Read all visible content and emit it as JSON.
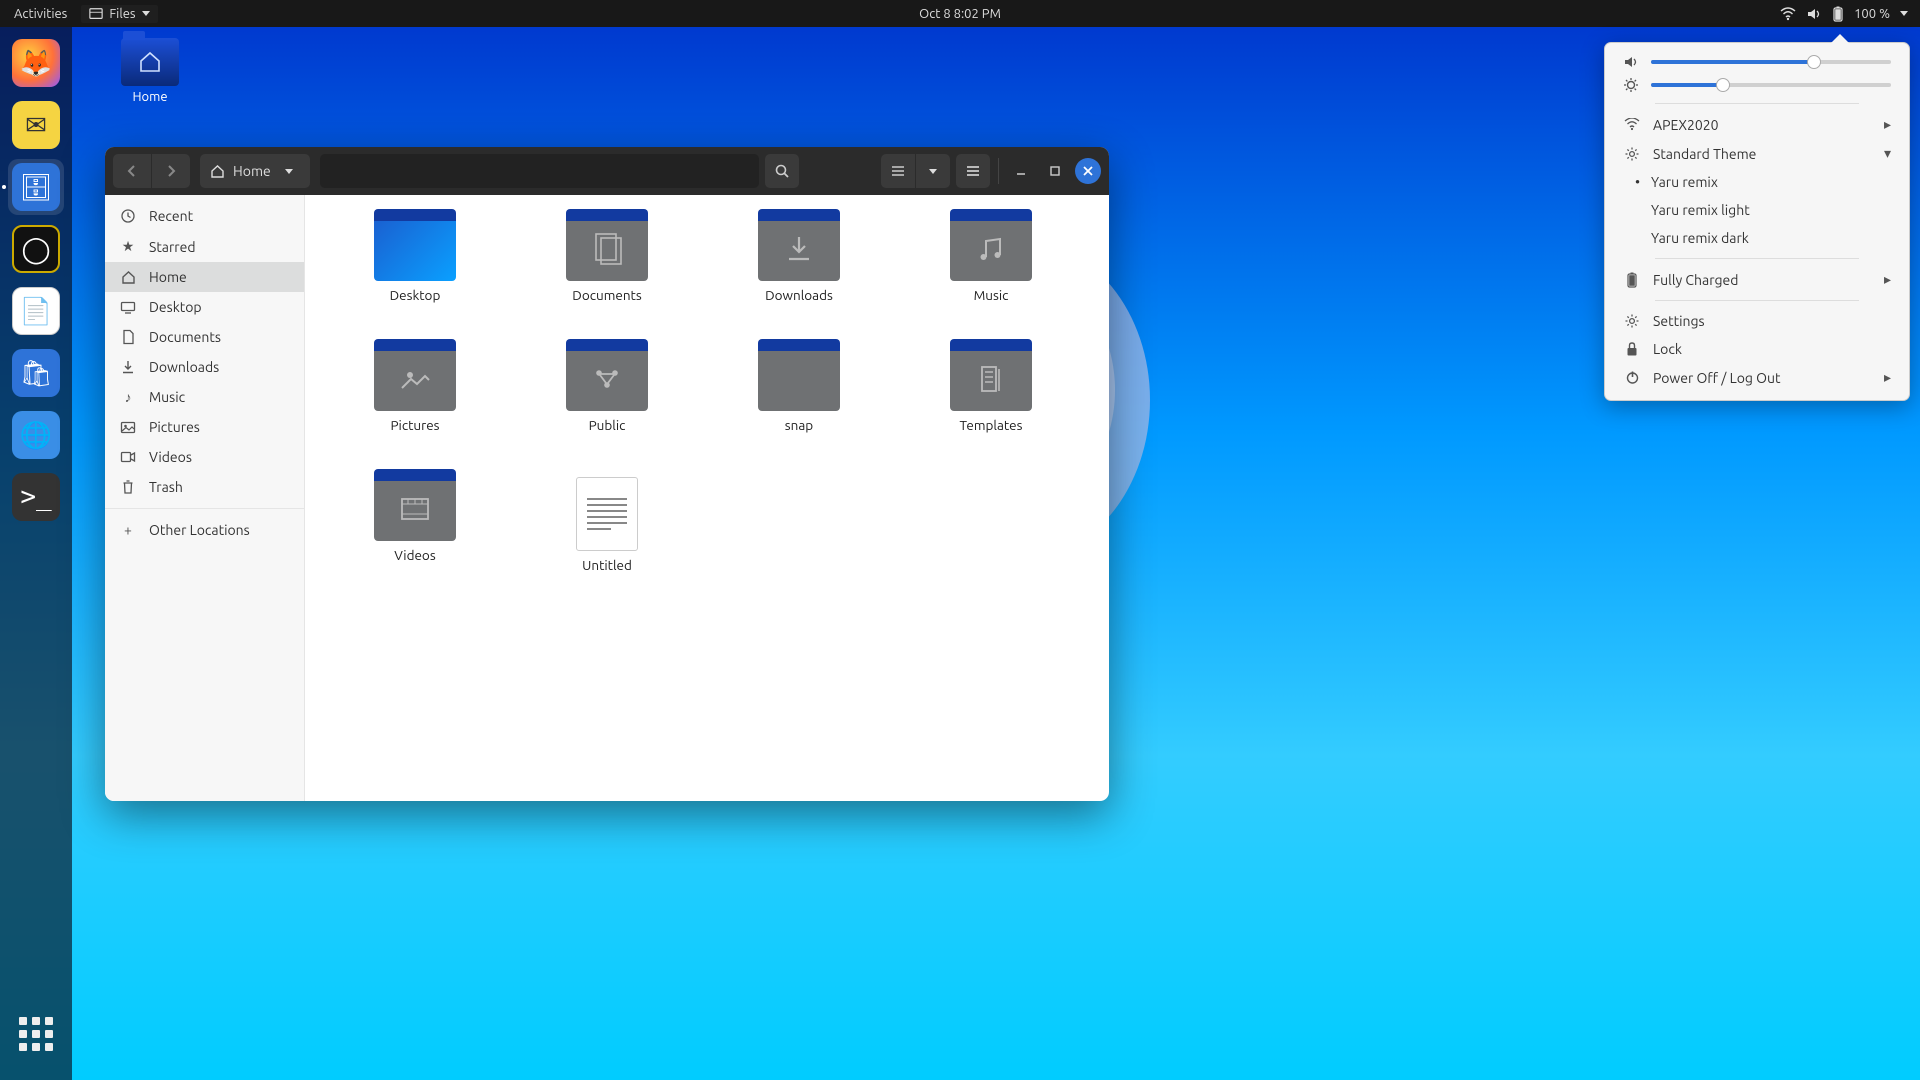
{
  "topbar": {
    "activities": "Activities",
    "app_label": "Files",
    "datetime": "Oct 8  8:02 PM",
    "battery": "100 %"
  },
  "desktop_icon": {
    "label": "Home"
  },
  "dock": {
    "items": [
      {
        "name": "firefox",
        "color": "#ff7139"
      },
      {
        "name": "mail",
        "color": "#f5d442"
      },
      {
        "name": "screenshots",
        "color": "#2e73d8"
      },
      {
        "name": "rhythmbox",
        "color": "#222"
      },
      {
        "name": "writer",
        "color": "#1e6fd9"
      },
      {
        "name": "software",
        "color": "#2e73d8"
      },
      {
        "name": "settings",
        "color": "#3a8ee6"
      },
      {
        "name": "terminal",
        "color": "#333"
      }
    ]
  },
  "fm": {
    "path_label": "Home",
    "sidebar": [
      "Recent",
      "Starred",
      "Home",
      "Desktop",
      "Documents",
      "Downloads",
      "Music",
      "Pictures",
      "Videos",
      "Trash",
      "Other Locations"
    ],
    "sidebar_active": 2,
    "files": [
      {
        "label": "Desktop",
        "kind": "desktop"
      },
      {
        "label": "Documents",
        "kind": "docs"
      },
      {
        "label": "Downloads",
        "kind": "downloads"
      },
      {
        "label": "Music",
        "kind": "music"
      },
      {
        "label": "Pictures",
        "kind": "pictures"
      },
      {
        "label": "Public",
        "kind": "public"
      },
      {
        "label": "snap",
        "kind": "plain"
      },
      {
        "label": "Templates",
        "kind": "templates"
      },
      {
        "label": "Videos",
        "kind": "videos"
      },
      {
        "label": "Untitled",
        "kind": "textfile"
      }
    ]
  },
  "sysmenu": {
    "volume_pct": 68,
    "brightness_pct": 30,
    "wifi": "APEX2020",
    "theme_label": "Standard Theme",
    "themes": [
      "Yaru remix",
      "Yaru remix light",
      "Yaru remix dark"
    ],
    "theme_selected": 0,
    "battery": "Fully Charged",
    "settings": "Settings",
    "lock": "Lock",
    "power": "Power Off / Log Out"
  }
}
